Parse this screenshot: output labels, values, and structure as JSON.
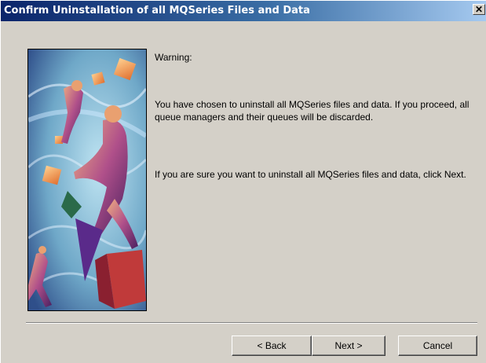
{
  "window": {
    "title": "Confirm Uninstallation of all MQSeries Files and Data",
    "close_glyph": "✕"
  },
  "content": {
    "warning_label": "Warning:",
    "paragraph1": "You have chosen to uninstall all MQSeries files and data. If you proceed, all queue managers and their queues will be discarded.",
    "paragraph2": "If you are sure you want to uninstall all MQSeries files and data, click Next."
  },
  "buttons": {
    "back": "< Back",
    "next": "Next >",
    "cancel": "Cancel"
  },
  "colors": {
    "titlebar_start": "#0a246a",
    "titlebar_end": "#a6caf0",
    "dialog_bg": "#d4d0c8"
  }
}
